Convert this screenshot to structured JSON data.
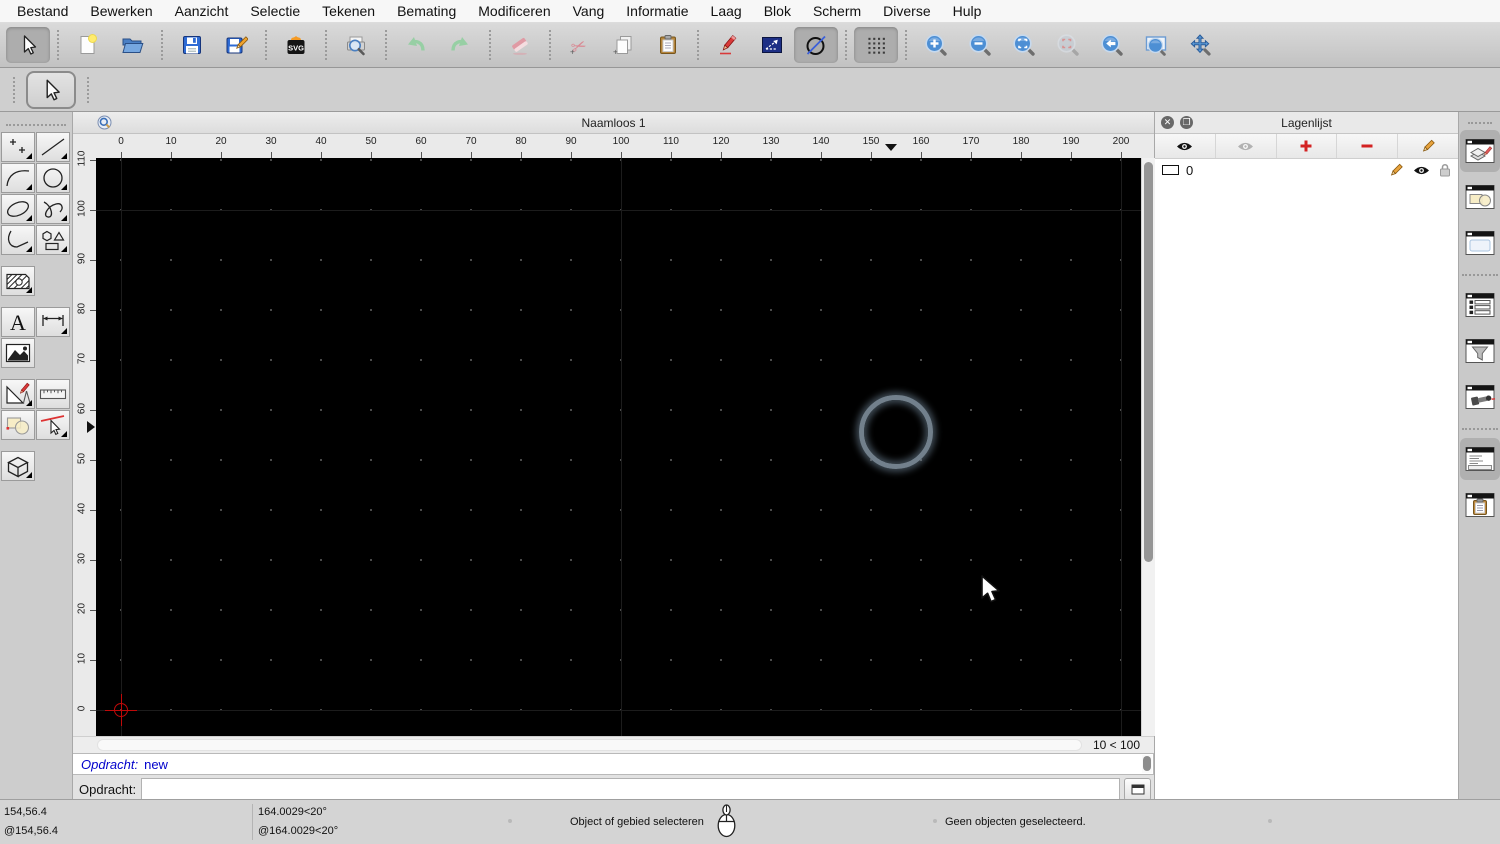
{
  "menu": {
    "items": [
      "Bestand",
      "Bewerken",
      "Aanzicht",
      "Selectie",
      "Tekenen",
      "Bemating",
      "Modificeren",
      "Vang",
      "Informatie",
      "Laag",
      "Blok",
      "Scherm",
      "Diverse",
      "Hulp"
    ]
  },
  "toolbar": {
    "current_tool": "select-arrow",
    "groups": [
      [
        {
          "name": "new"
        },
        {
          "name": "open"
        }
      ],
      [
        {
          "name": "save"
        },
        {
          "name": "save-as"
        }
      ],
      [
        {
          "name": "svg-export"
        }
      ],
      [
        {
          "name": "print-preview"
        }
      ],
      [
        {
          "name": "undo"
        },
        {
          "name": "redo"
        }
      ],
      [
        {
          "name": "delete"
        }
      ],
      [
        {
          "name": "cut"
        },
        {
          "name": "copy"
        },
        {
          "name": "paste"
        }
      ],
      [
        {
          "name": "draw-pencil"
        },
        {
          "name": "select-rectangle"
        },
        {
          "name": "circle-tool",
          "pressed": true
        }
      ],
      [
        {
          "name": "grid",
          "pressed": true
        }
      ],
      [
        {
          "name": "zoom-in"
        },
        {
          "name": "zoom-out"
        },
        {
          "name": "zoom-auto"
        },
        {
          "name": "zoom-selection",
          "disabled": true
        },
        {
          "name": "zoom-previous"
        },
        {
          "name": "zoom-window"
        },
        {
          "name": "pan"
        }
      ]
    ]
  },
  "palette": {
    "rows": [
      {
        "tools": [
          "points",
          "line"
        ]
      },
      {
        "tools": [
          "arc",
          "circle"
        ]
      },
      {
        "tools": [
          "ellipse",
          "spline"
        ]
      },
      {
        "tools": [
          "polyline",
          "shapes"
        ]
      },
      {
        "gap": true,
        "tools": [
          "hatch",
          null
        ]
      },
      {
        "gap": true,
        "tools": [
          "text",
          "dimension"
        ]
      },
      {
        "tools": [
          "image",
          null
        ]
      },
      {
        "gap": true,
        "tools": [
          "draw-tools",
          "measure"
        ]
      },
      {
        "tools": [
          "modify",
          "trim"
        ]
      },
      {
        "gap": true,
        "tools": [
          "solid-3d",
          null
        ]
      }
    ],
    "submenu": [
      "points",
      "line",
      "arc",
      "circle",
      "ellipse",
      "spline",
      "polyline",
      "shapes",
      "hatch",
      "dimension",
      "draw-tools",
      "trim",
      "solid-3d"
    ]
  },
  "document": {
    "title": "Naamloos 1",
    "grid_info": "10 < 100"
  },
  "rulers": {
    "horizontal": [
      "0",
      "10",
      "20",
      "30",
      "40",
      "50",
      "60",
      "70",
      "80",
      "90",
      "100",
      "110",
      "120",
      "130",
      "140",
      "150",
      "160",
      "170",
      "180",
      "190",
      "200"
    ],
    "vertical": [
      "0",
      "10",
      "20",
      "30",
      "40",
      "50",
      "60",
      "70",
      "80",
      "90",
      "100",
      "110"
    ]
  },
  "layer_panel": {
    "title": "Lagenlijst",
    "toolbar": [
      "show-all-layers",
      "hide-all-layers",
      "add-layer",
      "remove-layer",
      "edit-layer"
    ],
    "layers": [
      {
        "name": "0"
      }
    ]
  },
  "dock": {
    "buttons": [
      {
        "name": "layer-list",
        "selected": true
      },
      {
        "name": "block-list"
      },
      {
        "name": "library-browser"
      },
      {
        "sep": true
      },
      {
        "name": "view-list"
      },
      {
        "name": "selection-filter"
      },
      {
        "name": "inspector"
      },
      {
        "sep": true
      },
      {
        "name": "command-line",
        "selected": true
      },
      {
        "name": "property-editor"
      }
    ]
  },
  "command": {
    "history_prefix": "Opdracht:",
    "history_value": "new",
    "prompt_label": "Opdracht:",
    "input_value": "",
    "input_placeholder": ""
  },
  "status_bar": {
    "abs_coord": "154,56.4",
    "rel_coord": "@154,56.4",
    "abs_polar": "164.0029<20°",
    "rel_polar": "@164.0029<20°",
    "hint": "Object of gebied selecteren",
    "selection_status": "Geen objecten geselecteerd."
  },
  "colors": {
    "command_text": "#0000cc",
    "accent_red": "#d32222",
    "canvas_bg": "#000000"
  }
}
